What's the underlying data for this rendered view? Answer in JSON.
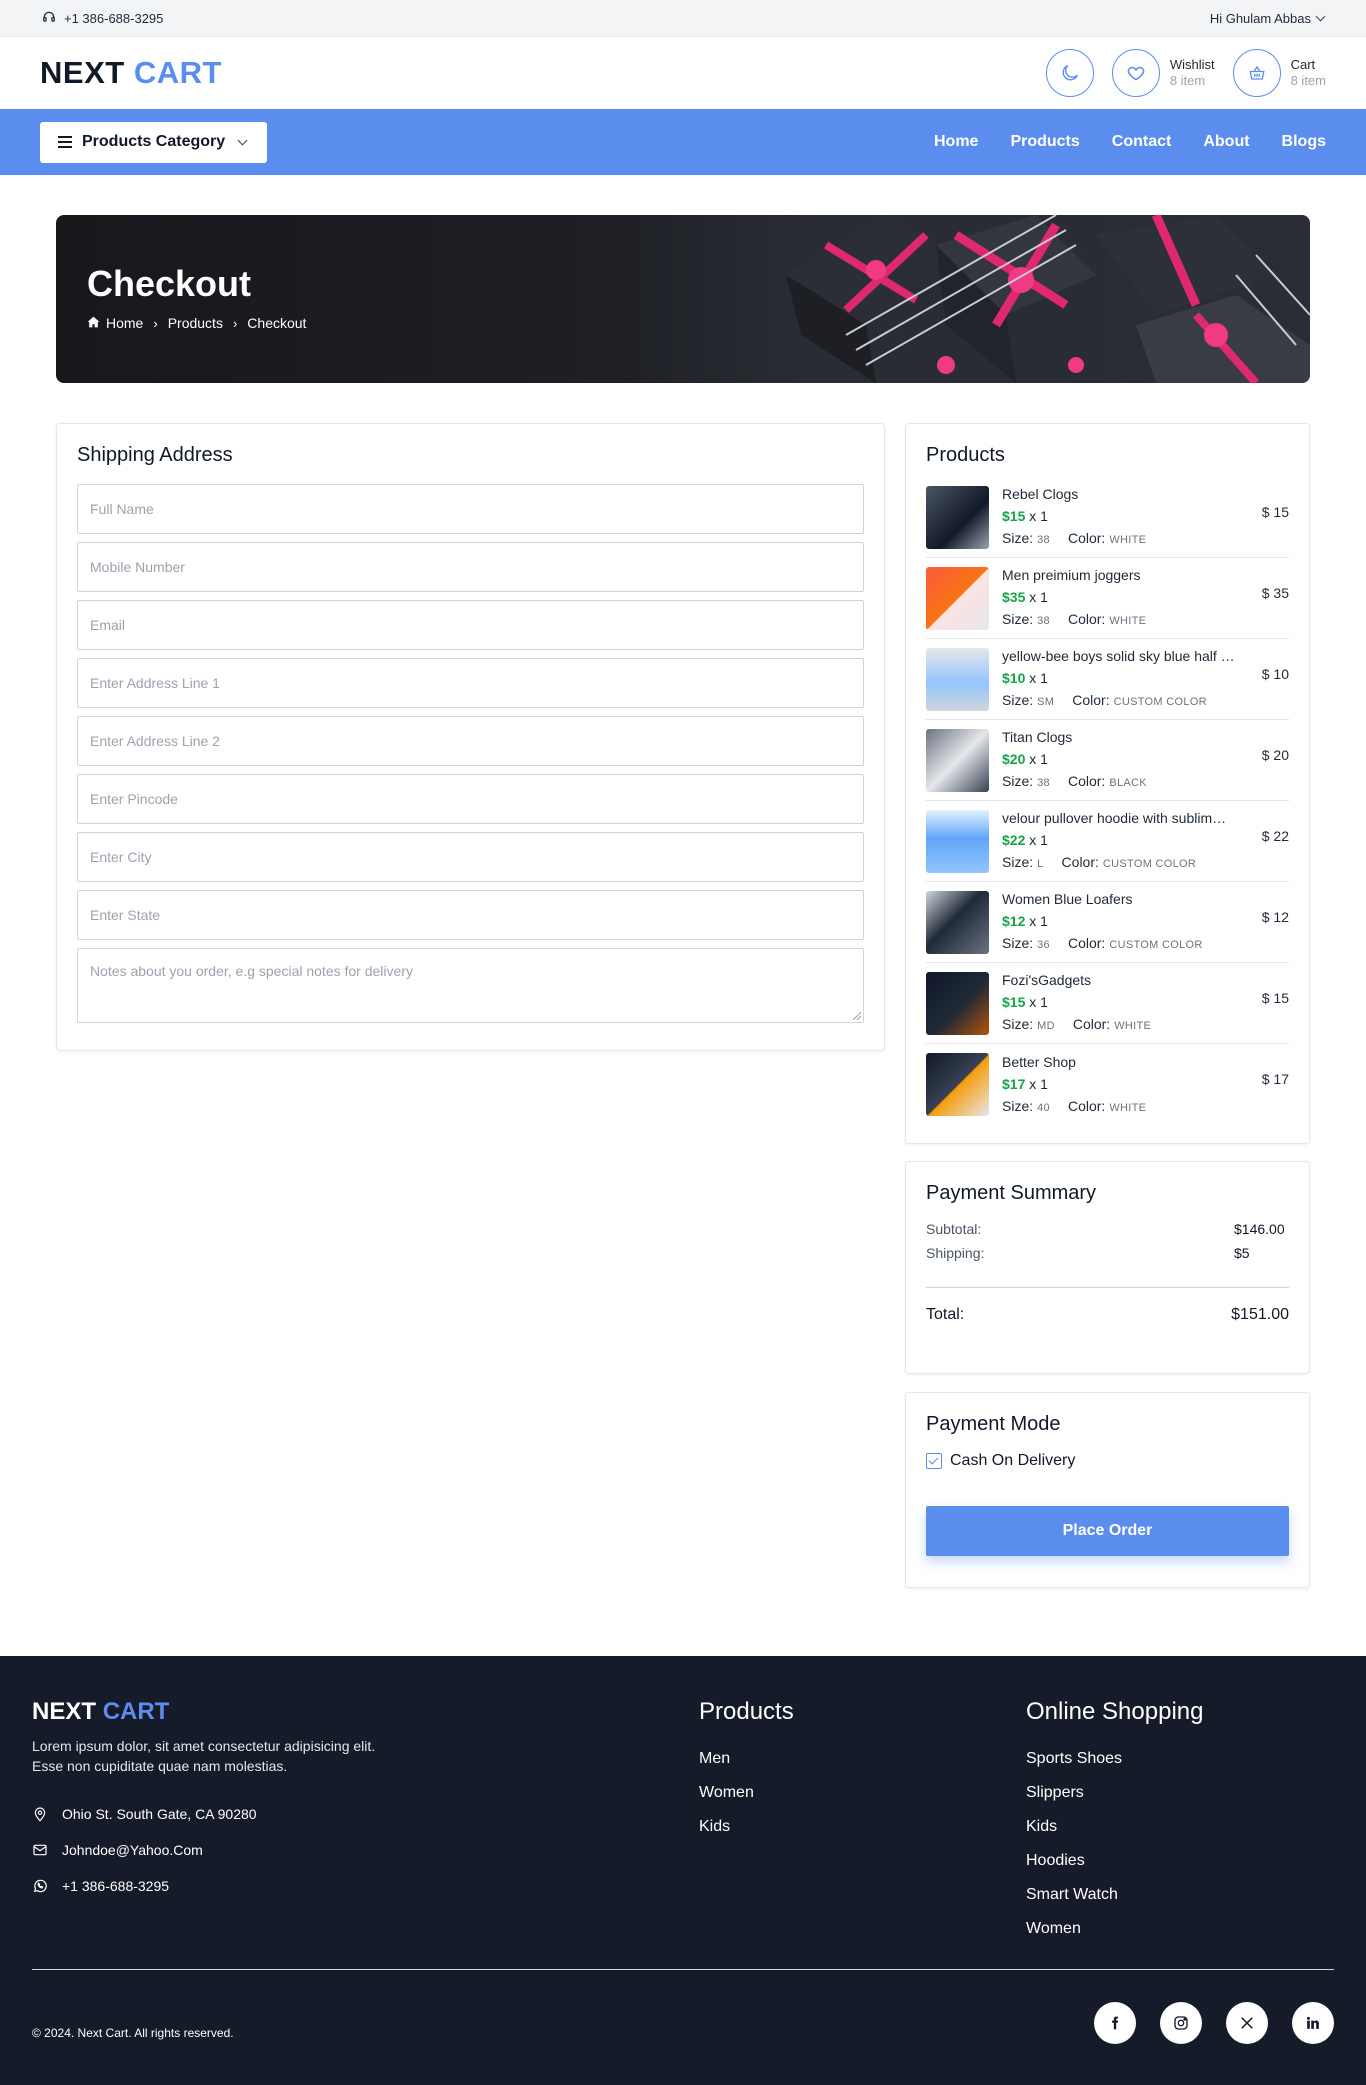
{
  "topbar": {
    "phone": "+1 386-688-3295",
    "greeting": "Hi Ghulam Abbas"
  },
  "header": {
    "logo_next": "NEXT",
    "logo_cart": "CART",
    "wishlist_label": "Wishlist",
    "wishlist_count": "8 item",
    "cart_label": "Cart",
    "cart_count": "8 item"
  },
  "nav": {
    "category_label": "Products Category",
    "links": [
      "Home",
      "Products",
      "Contact",
      "About",
      "Blogs"
    ]
  },
  "banner": {
    "title": "Checkout",
    "crumbs": [
      "Home",
      "Products",
      "Checkout"
    ]
  },
  "shipping": {
    "title": "Shipping Address",
    "placeholders": [
      "Full Name",
      "Mobile Number",
      "Email",
      "Enter Address Line 1",
      "Enter Address Line 2",
      "Enter Pincode",
      "Enter City",
      "Enter State"
    ],
    "notes_placeholder": "Notes about you order, e.g special notes for delivery"
  },
  "products": {
    "title": "Products",
    "size_label": "Size:",
    "color_label": "Color:",
    "items": [
      {
        "name": "Rebel Clogs",
        "price": "$15",
        "qty": "x 1",
        "size": "38",
        "color": "WHITE",
        "total": "$ 15"
      },
      {
        "name": "Men preimium joggers",
        "price": "$35",
        "qty": "x 1",
        "size": "38",
        "color": "WHITE",
        "total": "$ 35"
      },
      {
        "name": "yellow-bee boys solid sky blue half …",
        "price": "$10",
        "qty": "x 1",
        "size": "SM",
        "color": "CUSTOM COLOR",
        "total": "$ 10"
      },
      {
        "name": "Titan Clogs",
        "price": "$20",
        "qty": "x 1",
        "size": "38",
        "color": "BLACK",
        "total": "$ 20"
      },
      {
        "name": "velour pullover hoodie with sublim…",
        "price": "$22",
        "qty": "x 1",
        "size": "L",
        "color": "CUSTOM COLOR",
        "total": "$ 22"
      },
      {
        "name": "Women Blue Loafers",
        "price": "$12",
        "qty": "x 1",
        "size": "36",
        "color": "CUSTOM COLOR",
        "total": "$ 12"
      },
      {
        "name": "Fozi'sGadgets",
        "price": "$15",
        "qty": "x 1",
        "size": "MD",
        "color": "WHITE",
        "total": "$ 15"
      },
      {
        "name": "Better Shop",
        "price": "$17",
        "qty": "x 1",
        "size": "40",
        "color": "WHITE",
        "total": "$ 17"
      }
    ]
  },
  "summary": {
    "title": "Payment Summary",
    "subtotal_label": "Subtotal:",
    "subtotal": "$146.00",
    "shipping_label": "Shipping:",
    "shipping": "$5",
    "total_label": "Total:",
    "total": "$151.00"
  },
  "payment": {
    "title": "Payment Mode",
    "option": "Cash On Delivery",
    "button": "Place Order"
  },
  "footer": {
    "logo_next": "NEXT",
    "logo_cart": "CART",
    "description_line1": "Lorem ipsum dolor, sit amet consectetur adipisicing elit.",
    "description_line2": "Esse non cupiditate quae nam molestias.",
    "address": "Ohio St. South Gate, CA 90280",
    "email": "Johndoe@Yahoo.Com",
    "phone": "+1 386-688-3295",
    "products_title": "Products",
    "products_links": [
      "Men",
      "Women",
      "Kids"
    ],
    "shopping_title": "Online Shopping",
    "shopping_links": [
      "Sports Shoes",
      "Slippers",
      "Kids",
      "Hoodies",
      "Smart Watch",
      "Women"
    ],
    "copyright": "© 2024. Next Cart. All rights reserved.",
    "social": [
      "facebook-icon",
      "instagram-icon",
      "x-icon",
      "linkedin-icon"
    ]
  },
  "colors": {
    "accent": "#5b8def",
    "price_green": "#16a34a",
    "footer_bg": "#151b28"
  }
}
